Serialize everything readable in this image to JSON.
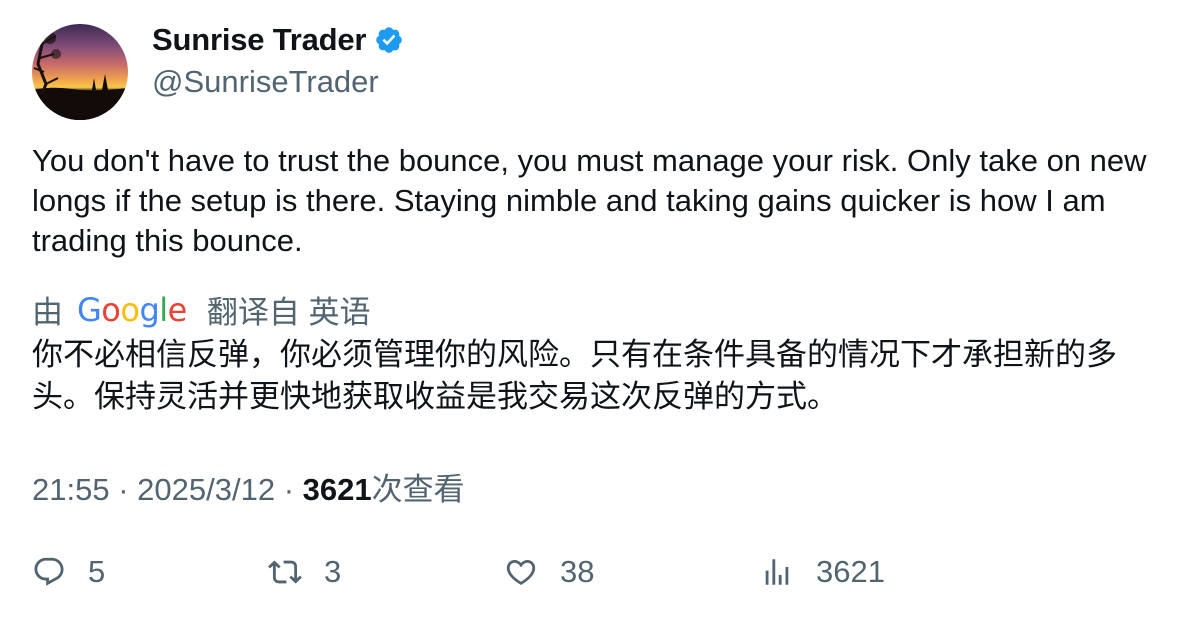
{
  "author": {
    "display_name": "Sunrise Trader",
    "handle": "@SunriseTrader",
    "verified": true,
    "avatar_icon": "sunset-landscape-avatar"
  },
  "tweet": {
    "text": "You don't have to trust the bounce, you must manage your risk.  Only take on new longs if the setup is there.  Staying nimble and taking gains quicker is how I am trading this bounce."
  },
  "translation": {
    "prefix": "由",
    "provider_letters": [
      "G",
      "o",
      "o",
      "g",
      "l",
      "e"
    ],
    "suffix": "翻译自 英语",
    "text": "你不必相信反弹，你必须管理你的风险。只有在条件具备的情况下才承担新的多头。保持灵活并更快地获取收益是我交易这次反弹的方式。"
  },
  "meta": {
    "time": "21:55",
    "separator": "·",
    "date": "2025/3/12",
    "views_count": "3621",
    "views_label": "次查看"
  },
  "actions": {
    "replies": "5",
    "retweets": "3",
    "likes": "38",
    "views": "3621"
  },
  "colors": {
    "text_primary": "#0f1419",
    "text_secondary": "#536471",
    "verified_blue": "#1d9bf0"
  }
}
